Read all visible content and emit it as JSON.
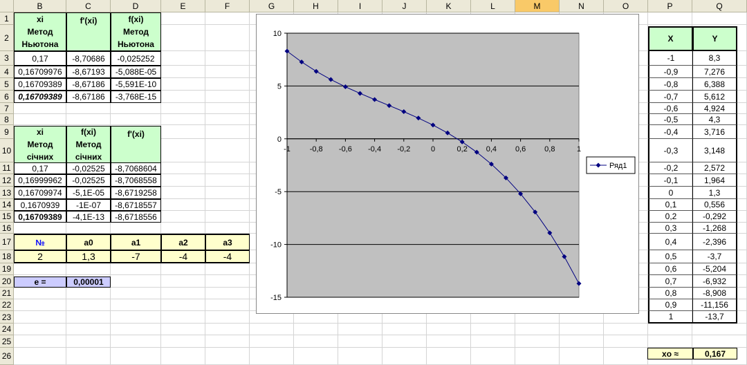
{
  "columns": [
    "B",
    "C",
    "D",
    "E",
    "F",
    "G",
    "H",
    "I",
    "J",
    "K",
    "L",
    "M",
    "N",
    "O",
    "P",
    "Q"
  ],
  "selected_column": "M",
  "rows": [
    "1",
    "2",
    "3",
    "4",
    "5",
    "6",
    "7",
    "8",
    "9",
    "10",
    "11",
    "12",
    "13",
    "14",
    "15",
    "16",
    "17",
    "18",
    "19",
    "20",
    "21",
    "22",
    "23",
    "24",
    "25",
    "26"
  ],
  "newton": {
    "hdr_b1": "xi",
    "hdr_b2": "Метод",
    "hdr_b3": "Ньютона",
    "hdr_c1": "f'(xi)",
    "hdr_d1": "f(xi)",
    "hdr_d2": "Метод",
    "hdr_d3": "Ньютона",
    "rows": [
      [
        "0,17",
        "-8,70686",
        "-0,025252"
      ],
      [
        "0,16709976",
        "-8,67193",
        "-5,088E-05"
      ],
      [
        "0,16709389",
        "-8,67186",
        "-5,591E-10"
      ],
      [
        "0,16709389",
        "-8,67186",
        "-3,768E-15"
      ]
    ]
  },
  "secant": {
    "hdr_b1": "xi",
    "hdr_b2": "Метод",
    "hdr_b3": "січних",
    "hdr_c1": "f(xi)",
    "hdr_c2": "Метод",
    "hdr_c3": "січних",
    "hdr_d1": "f'(xi)",
    "rows": [
      [
        "0,17",
        "-0,02525",
        "-8,7068604"
      ],
      [
        "0,16999962",
        "-0,02525",
        "-8,7068558"
      ],
      [
        "0,16709974",
        "-5,1E-05",
        "-8,6719258"
      ],
      [
        "0,1670939",
        "-1E-07",
        "-8,6718557"
      ],
      [
        "0,16709389",
        "-4,1E-13",
        "-8,6718556"
      ]
    ]
  },
  "coef": {
    "headers": [
      "№",
      "a0",
      "a1",
      "a2",
      "a3"
    ],
    "values": [
      "2",
      "1,3",
      "-7",
      "-4",
      "-4"
    ]
  },
  "eps": {
    "label": "e =",
    "value": "0,00001"
  },
  "xy": {
    "hdr_x": "X",
    "hdr_y": "Y",
    "rows": [
      [
        "-1",
        "8,3"
      ],
      [
        "-0,9",
        "7,276"
      ],
      [
        "-0,8",
        "6,388"
      ],
      [
        "-0,7",
        "5,612"
      ],
      [
        "-0,6",
        "4,924"
      ],
      [
        "-0,5",
        "4,3"
      ],
      [
        "-0,4",
        "3,716"
      ],
      [
        "-0,3",
        "3,148"
      ],
      [
        "-0,2",
        "2,572"
      ],
      [
        "-0,1",
        "1,964"
      ],
      [
        "0",
        "1,3"
      ],
      [
        "0,1",
        "0,556"
      ],
      [
        "0,2",
        "-0,292"
      ],
      [
        "0,3",
        "-1,268"
      ],
      [
        "0,4",
        "-2,396"
      ],
      [
        "0,5",
        "-3,7"
      ],
      [
        "0,6",
        "-5,204"
      ],
      [
        "0,7",
        "-6,932"
      ],
      [
        "0,8",
        "-8,908"
      ],
      [
        "0,9",
        "-11,156"
      ],
      [
        "1",
        "-13,7"
      ]
    ]
  },
  "result": {
    "label": "xo ≈",
    "value": "0,167"
  },
  "colors": {
    "plot_bg": "#c0c0c0",
    "series": "#000080",
    "green": "#ccffcc",
    "yellow": "#ffffcc",
    "lavender": "#ccccff"
  },
  "chart_data": {
    "type": "line",
    "title": "",
    "xlabel": "",
    "ylabel": "",
    "x": [
      -1,
      -0.9,
      -0.8,
      -0.7,
      -0.6,
      -0.5,
      -0.4,
      -0.3,
      -0.2,
      -0.1,
      0,
      0.1,
      0.2,
      0.3,
      0.4,
      0.5,
      0.6,
      0.7,
      0.8,
      0.9,
      1
    ],
    "series": [
      {
        "name": "Ряд1",
        "values": [
          8.3,
          7.276,
          6.388,
          5.612,
          4.924,
          4.3,
          3.716,
          3.148,
          2.572,
          1.964,
          1.3,
          0.556,
          -0.292,
          -1.268,
          -2.396,
          -3.7,
          -5.204,
          -6.932,
          -8.908,
          -11.156,
          -13.7
        ]
      }
    ],
    "xlim": [
      -1,
      1
    ],
    "ylim": [
      -15,
      10
    ],
    "xticks": [
      "-1",
      "-0,8",
      "-0,6",
      "-0,4",
      "-0,2",
      "0",
      "0,2",
      "0,4",
      "0,6",
      "0,8",
      "1"
    ],
    "yticks": [
      "10",
      "5",
      "0",
      "-5",
      "-10",
      "-15"
    ],
    "grid": "horizontal major lines",
    "legend": "right"
  }
}
